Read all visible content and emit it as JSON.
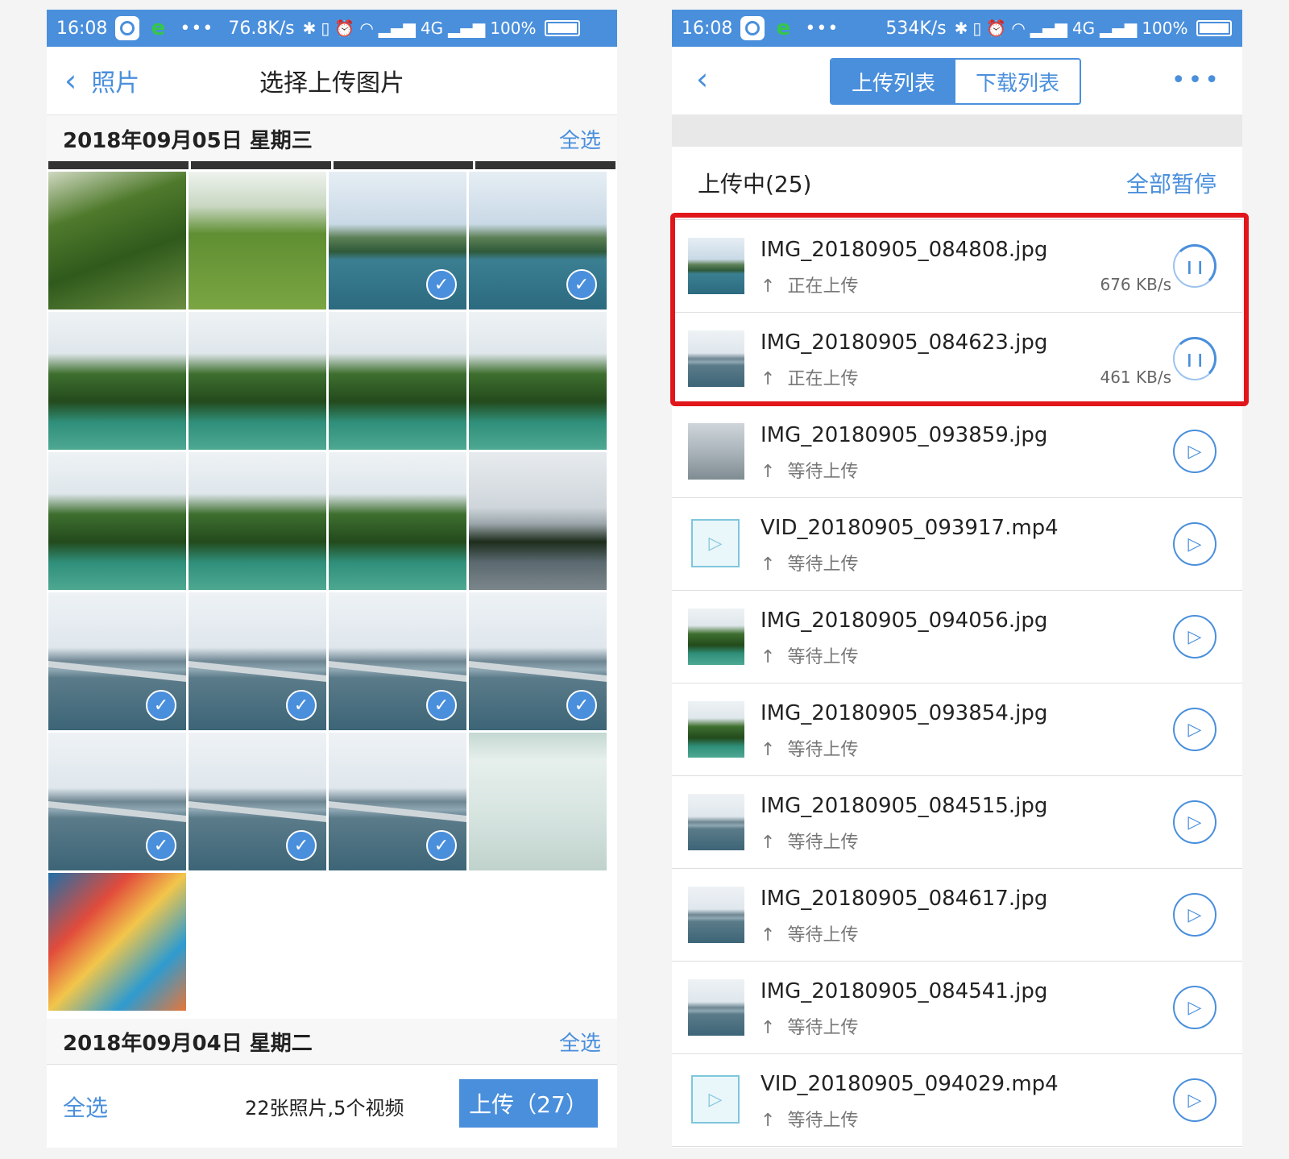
{
  "left": {
    "status": {
      "time": "16:08",
      "speed": "76.8K/s",
      "battery": "100%",
      "network": "4G"
    },
    "nav": {
      "back_label": "照片",
      "title": "选择上传图片"
    },
    "date1": {
      "label": "2018年09月05日 星期三",
      "select_all": "全选"
    },
    "date2": {
      "label": "2018年09月04日 星期二",
      "select_all": "全选"
    },
    "grid_cells": [
      {
        "scene": "model",
        "checked": false
      },
      {
        "scene": "model2",
        "checked": false
      },
      {
        "scene": "lake",
        "checked": true
      },
      {
        "scene": "lake",
        "checked": true
      },
      {
        "scene": "hill",
        "checked": false
      },
      {
        "scene": "hill",
        "checked": false
      },
      {
        "scene": "hill",
        "checked": false
      },
      {
        "scene": "hill",
        "checked": false
      },
      {
        "scene": "hill",
        "checked": false
      },
      {
        "scene": "hill",
        "checked": false
      },
      {
        "scene": "hill",
        "checked": false
      },
      {
        "scene": "dark",
        "checked": false
      },
      {
        "scene": "bridge",
        "checked": true
      },
      {
        "scene": "bridge",
        "checked": true
      },
      {
        "scene": "bridge",
        "checked": true
      },
      {
        "scene": "bridge",
        "checked": true
      },
      {
        "scene": "bridge",
        "checked": true
      },
      {
        "scene": "bridge",
        "checked": true
      },
      {
        "scene": "bridge",
        "checked": true
      },
      {
        "scene": "doc",
        "checked": false
      },
      {
        "scene": "poster",
        "checked": false
      }
    ],
    "bottom": {
      "select_all": "全选",
      "count": "22张照片,5个视频",
      "upload_label": "上传（27）"
    }
  },
  "right": {
    "status": {
      "time": "16:08",
      "speed": "534K/s",
      "battery": "100%",
      "network": "4G"
    },
    "tabs": {
      "upload": "上传列表",
      "download": "下载列表"
    },
    "section": {
      "title": "上传中(25)",
      "pause_all": "全部暂停"
    },
    "items": [
      {
        "name": "IMG_20180905_084808.jpg",
        "status": "正在上传",
        "speed": "676 KB/s",
        "state": "uploading",
        "thumb": "lake"
      },
      {
        "name": "IMG_20180905_084623.jpg",
        "status": "正在上传",
        "speed": "461 KB/s",
        "state": "uploading",
        "thumb": "bridge"
      },
      {
        "name": "IMG_20180905_093859.jpg",
        "status": "等待上传",
        "speed": "",
        "state": "waiting",
        "thumb": "grey"
      },
      {
        "name": "VID_20180905_093917.mp4",
        "status": "等待上传",
        "speed": "",
        "state": "waiting",
        "thumb": "video"
      },
      {
        "name": "IMG_20180905_094056.jpg",
        "status": "等待上传",
        "speed": "",
        "state": "waiting",
        "thumb": "hill"
      },
      {
        "name": "IMG_20180905_093854.jpg",
        "status": "等待上传",
        "speed": "",
        "state": "waiting",
        "thumb": "hill"
      },
      {
        "name": "IMG_20180905_084515.jpg",
        "status": "等待上传",
        "speed": "",
        "state": "waiting",
        "thumb": "bridge"
      },
      {
        "name": "IMG_20180905_084617.jpg",
        "status": "等待上传",
        "speed": "",
        "state": "waiting",
        "thumb": "bridge"
      },
      {
        "name": "IMG_20180905_084541.jpg",
        "status": "等待上传",
        "speed": "",
        "state": "waiting",
        "thumb": "bridge"
      },
      {
        "name": "VID_20180905_094029.mp4",
        "status": "等待上传",
        "speed": "",
        "state": "waiting",
        "thumb": "video"
      }
    ]
  },
  "colors": {
    "accent": "#4a8fdc",
    "highlight": "#e0161b",
    "status_bar": "#4a8fdc"
  }
}
